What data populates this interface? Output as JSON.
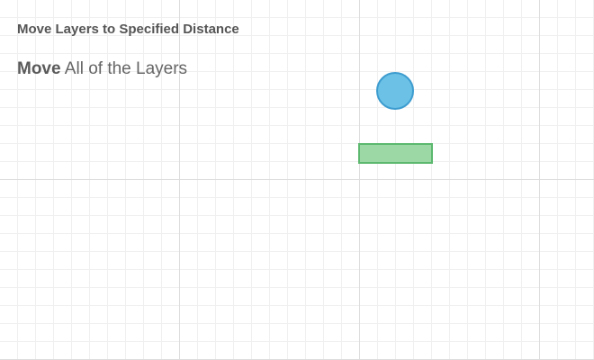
{
  "header": {
    "title": "Move Layers to Specified Distance"
  },
  "instruction": {
    "verb": "Move",
    "rest": " All of the Layers"
  },
  "layers": {
    "circle": {
      "shape": "circle",
      "fill": "#6bc1e6",
      "stroke": "#3d9ccf"
    },
    "rectangle": {
      "shape": "rectangle",
      "fill": "#9bd8a5",
      "stroke": "#5cb86e"
    }
  },
  "grid": {
    "minor_line_color": "#efefef",
    "major_line_color": "#dcdcdc"
  }
}
